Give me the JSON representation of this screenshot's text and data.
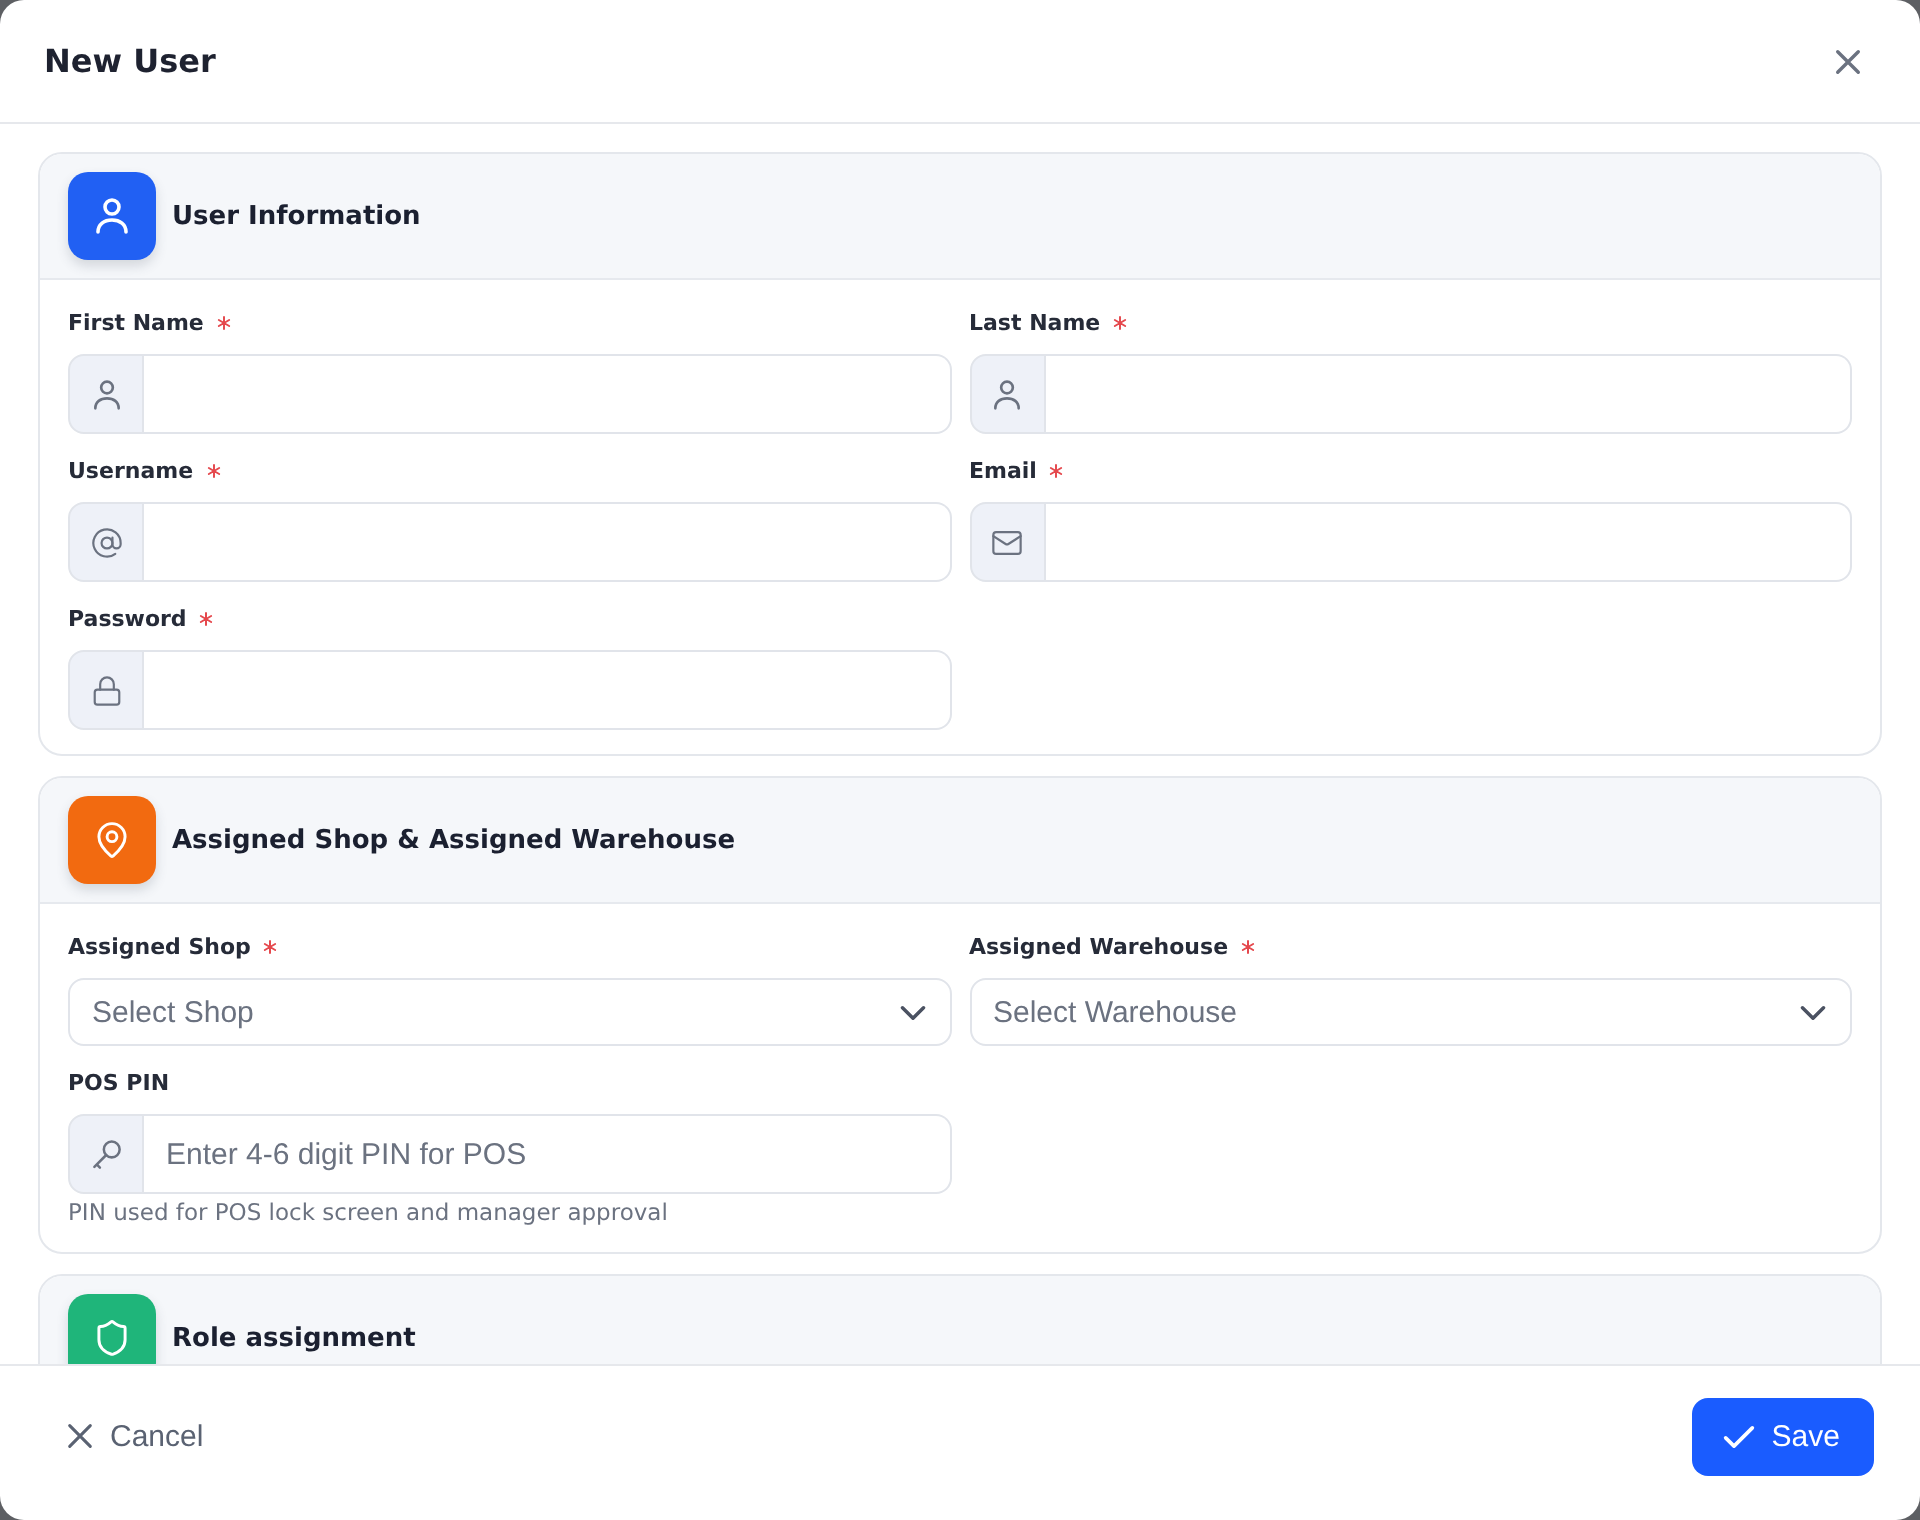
{
  "dialog": {
    "title": "New User"
  },
  "sections": [
    {
      "kind": "profile",
      "title": "User Information",
      "color": "#2160f3",
      "fields": [
        {
          "kind": "name",
          "label": "First Name",
          "required": true
        },
        {
          "kind": "name",
          "label": "Last Name",
          "required": true
        },
        {
          "kind": "username",
          "label": "Username",
          "required": true
        },
        {
          "kind": "email",
          "label": "Email",
          "required": true
        },
        {
          "kind": "password",
          "label": "Password",
          "required": true
        }
      ]
    },
    {
      "kind": "location",
      "title": "Assigned Shop & Assigned Warehouse",
      "color": "#f26a10",
      "fields": [
        {
          "kind": "select",
          "label": "Assigned Shop",
          "required": true,
          "placeholder": "Select Shop"
        },
        {
          "kind": "select",
          "label": "Assigned Warehouse",
          "required": true,
          "placeholder": "Select Warehouse"
        },
        {
          "kind": "pin",
          "label": "POS PIN",
          "required": false,
          "placeholder": "Enter 4-6 digit PIN for POS",
          "hint": "PIN used for POS lock screen and manager approval"
        }
      ]
    },
    {
      "kind": "roles",
      "title": "Role assignment",
      "color": "#1fb57a"
    }
  ],
  "footer": {
    "buttons": [
      {
        "kind": "secondary",
        "label": "Cancel"
      },
      {
        "kind": "primary",
        "label": "Save"
      }
    ]
  }
}
